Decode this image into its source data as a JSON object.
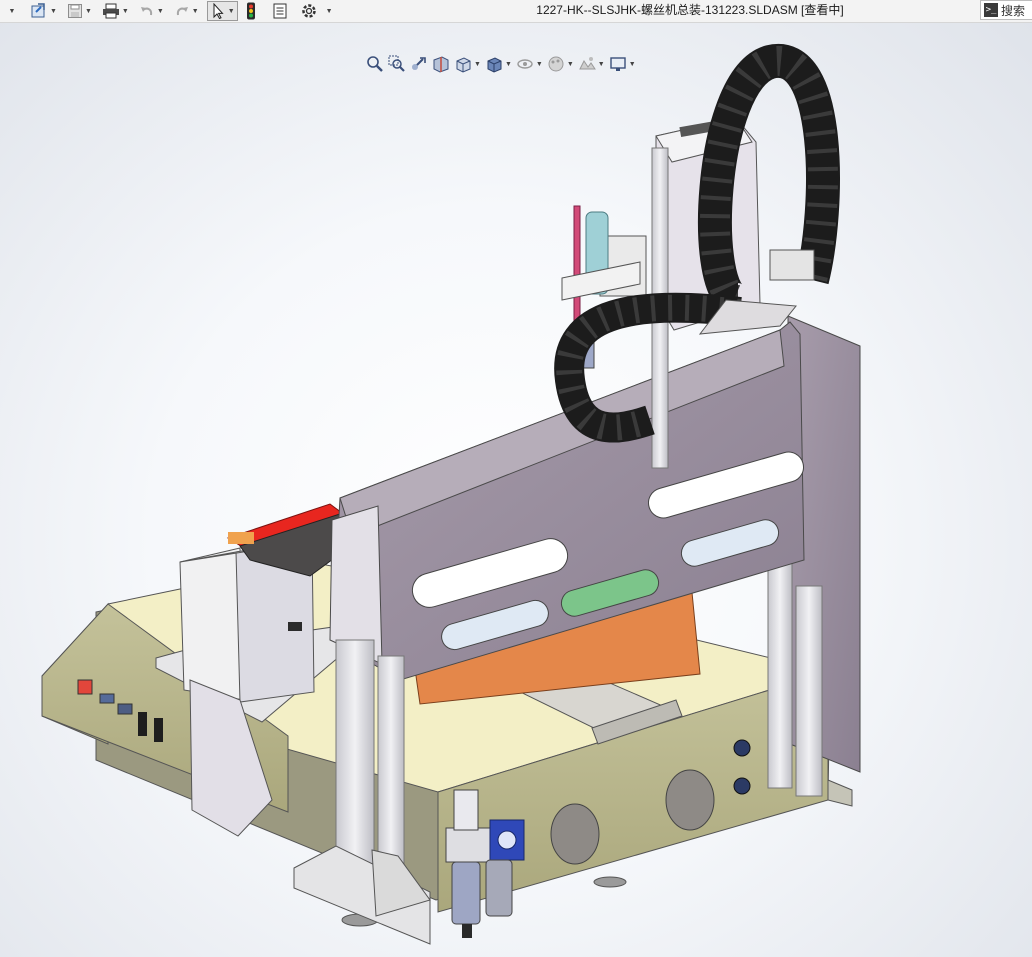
{
  "window": {
    "title": "1227-HK--SLSJHK-螺丝机总装-131223.SLDASM [查看中]"
  },
  "search": {
    "label": "搜索"
  },
  "toolbar": {
    "items": [
      {
        "icon": "dropdown-arrow-icon"
      },
      {
        "icon": "open-file-icon"
      },
      {
        "icon": "save-icon"
      },
      {
        "icon": "print-icon"
      },
      {
        "icon": "undo-icon"
      },
      {
        "icon": "redo-icon"
      },
      {
        "icon": "select-cursor-icon"
      },
      {
        "icon": "traffic-light-icon"
      },
      {
        "icon": "file-properties-icon"
      },
      {
        "icon": "options-gear-icon"
      }
    ]
  },
  "headsup_toolbar": {
    "items": [
      "zoom-to-fit-icon",
      "zoom-to-area-icon",
      "previous-view-icon",
      "section-view-icon",
      "view-orientation-icon",
      "display-style-icon",
      "hide-show-items-icon",
      "edit-appearance-icon",
      "apply-scene-icon",
      "view-settings-icon"
    ]
  },
  "colors": {
    "toolbar_bg": "#f3f3f3",
    "frame_purple": "#9a8e9e",
    "base_khaki": "#b8b68e",
    "base_top_cream": "#f3efc6",
    "cable_chain_black": "#1c1c1c",
    "orange_block": "#e4874a",
    "red_strip": "#e8261f",
    "aluminum": "#d9d9de"
  }
}
